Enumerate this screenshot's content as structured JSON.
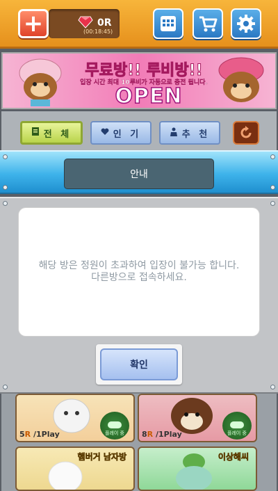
{
  "top_bar": {
    "ruby_count": "0R",
    "timer": "(00:18:45)"
  },
  "banner": {
    "title": "무료방!! 루비방!!",
    "subtitle": "입장 시간 최대 10루비가 자동으로 충전 됩니다.",
    "open": "OPEN"
  },
  "tabs": [
    {
      "label": "전 체"
    },
    {
      "label": "인 기"
    },
    {
      "label": "추 천"
    }
  ],
  "dialog": {
    "title": "안내",
    "message_line1": "해당 방은 정원이 초과하여 입장이 불가능 합니다.",
    "message_line2": "다른방으로 접속하세요.",
    "ok_label": "확인"
  },
  "rooms": [
    {
      "price_num": "5",
      "price_unit": "R",
      "price_suffix": "/1Play",
      "status": "플레이 중"
    },
    {
      "price_num": "8",
      "price_unit": "R",
      "price_suffix": "/1Play",
      "status": "플레이 중"
    },
    {
      "name": "햄버거 남자방"
    },
    {
      "name": "이상해씨"
    }
  ],
  "colors": {
    "topbar": "#f0a02a",
    "dialog_header": "#3eb3ea",
    "ok_button": "#a5c0ef"
  }
}
